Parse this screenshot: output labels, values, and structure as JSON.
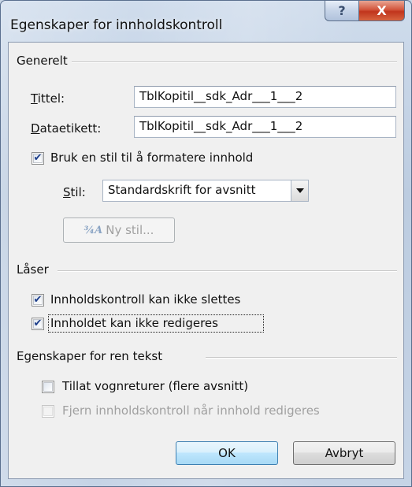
{
  "window": {
    "title": "Egenskaper for innholdskontroll",
    "help_glyph": "?",
    "close_glyph": "X"
  },
  "general": {
    "group_title": "Generelt",
    "title_label": "Tittel:",
    "title_value": "TblKopitil__sdk_Adr___1___2",
    "tag_label": "Dataetikett:",
    "tag_value": "TblKopitil__sdk_Adr___1___2",
    "use_style_label": "Bruk en stil til å formatere innhold",
    "use_style_checked": true,
    "style_label": "Stil:",
    "style_value": "Standardskrift for avsnitt",
    "new_style_label": "Ny stil..."
  },
  "locking": {
    "group_title": "Låser",
    "cannot_delete_label": "Innholdskontroll kan ikke slettes",
    "cannot_delete_checked": true,
    "cannot_edit_label": "Innholdet kan ikke redigeres",
    "cannot_edit_checked": true
  },
  "plain_text": {
    "group_title": "Egenskaper for ren tekst",
    "allow_returns_label": "Tillat vognreturer (flere avsnitt)",
    "allow_returns_checked": false,
    "remove_control_label": "Fjern innholdskontroll når innhold redigeres",
    "remove_control_checked": false
  },
  "buttons": {
    "ok": "OK",
    "cancel": "Avbryt"
  },
  "colors": {
    "accent": "#3c7fb1",
    "check": "#1c3d8a"
  }
}
